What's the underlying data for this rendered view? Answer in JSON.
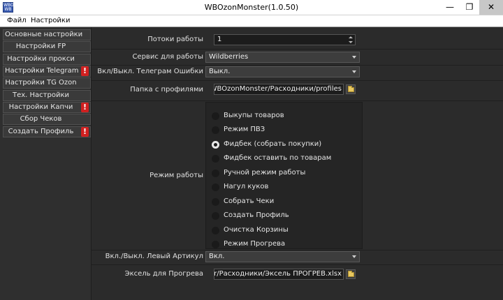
{
  "window": {
    "title": "WBOzonMonster(1.0.50)",
    "icon_text": [
      "WBOZ",
      "WB"
    ],
    "controls": [
      "—",
      "❐",
      "✕"
    ]
  },
  "menu": [
    "Файл",
    "Настройки"
  ],
  "nav": {
    "items": [
      {
        "label": "Основные настройки",
        "warning": false
      },
      {
        "label": "Настройки FP",
        "warning": false
      },
      {
        "label": "Настройки прокси",
        "warning": false
      },
      {
        "label": "Настройки Telegram",
        "warning": true
      },
      {
        "label": "Настройки TG Ozon",
        "warning": false
      },
      {
        "label": "Тех. Настройки",
        "warning": false
      },
      {
        "label": "Настройки Капчи",
        "warning": true
      },
      {
        "label": "Сбор Чеков",
        "warning": false
      },
      {
        "label": "Создать Профиль",
        "warning": true
      }
    ],
    "warning_glyph": "!"
  },
  "form": {
    "threads_label": "Потоки работы",
    "threads_value": "1",
    "service_label": "Сервис для работы",
    "service_value": "Wildberries",
    "tg_errors_label": "Вкл/Выкл. Телеграм Ошибки",
    "tg_errors_value": "Выкл.",
    "profiles_label": "Папка с профилями",
    "profiles_path": "sktop/WBOzonMonster/Расходники/profiles",
    "mode_label": "Режим работы",
    "modes": [
      "Выкупы товаров",
      "Режим ПВЗ",
      "Фидбек (собрать покупки)",
      "Фидбек оставить по товарам",
      "Ручной режим работы",
      "Нагул куков",
      "Собрать Чеки",
      "Создать Профиль",
      "Очистка Корзины",
      "Режим Прогрева"
    ],
    "selected_mode": "Фидбек (собрать покупки)",
    "left_article_label": "Вкл./Выкл. Левый Артикул",
    "left_article_value": "Вкл.",
    "warmup_excel_label": "Эксель для Прогрева",
    "warmup_excel_path": "Monster/Расходники/Эксель ПРОГРЕВ.xlsx"
  },
  "colors": {
    "background": "#2b2b2b",
    "warning": "#d02020",
    "folder_icon": "#e8c860"
  }
}
